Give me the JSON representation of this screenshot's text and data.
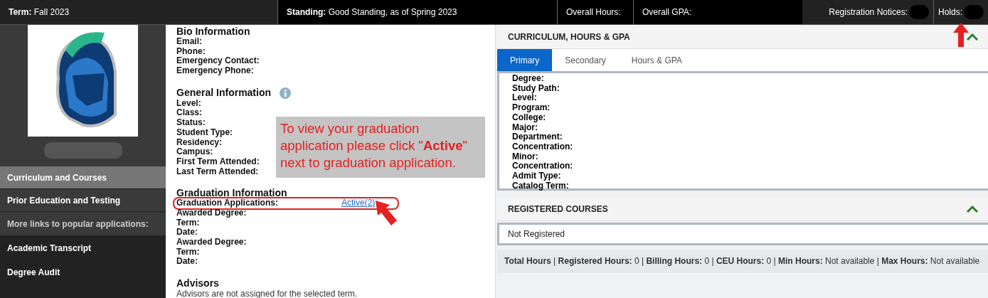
{
  "top_bar": {
    "term": "**Term:** Fall 2023",
    "standing": "**Standing:** Good Standing, as of Spring 2023",
    "overall_hours": "Overall Hours:",
    "overall_gpa": "Overall GPA:",
    "registration_notices": "Registration Notices:",
    "holds": "Holds:"
  },
  "sidebar": {
    "items": [
      {
        "label": "Curriculum and Courses",
        "kind": "tab",
        "selected": true
      },
      {
        "label": "Prior Education and Testing",
        "kind": "tab",
        "selected": false
      },
      {
        "label": "More links to popular applications:",
        "kind": "heading",
        "selected": false
      },
      {
        "label": "Academic Transcript",
        "kind": "link",
        "selected": false
      },
      {
        "label": "Degree Audit",
        "kind": "link",
        "selected": false
      }
    ]
  },
  "sections": [
    {
      "title": "Bio Information",
      "fields": [
        {
          "label": "Email:"
        },
        {
          "label": "Phone:"
        },
        {
          "label": "Emergency Contact:"
        },
        {
          "label": "Emergency Phone:"
        }
      ]
    },
    {
      "title": "General Information",
      "info": true,
      "fields": [
        {
          "label": "Level:"
        },
        {
          "label": "Class:"
        },
        {
          "label": "Status:"
        },
        {
          "label": "Student Type:"
        },
        {
          "label": "Residency:"
        },
        {
          "label": "Campus:"
        },
        {
          "label": "First Term Attended:"
        },
        {
          "label": "Last Term Attended:"
        }
      ]
    },
    {
      "title": "Graduation Information",
      "fields": [
        {
          "label": "Graduation Applications:",
          "value": "Active(2)",
          "highlighted": true
        },
        {
          "label": "Awarded Degree:"
        },
        {
          "label": "Term:"
        },
        {
          "label": "Date:"
        },
        {
          "label": "Awarded Degree:"
        },
        {
          "label": "Term:"
        },
        {
          "label": "Date:"
        }
      ]
    },
    {
      "title": "Advisors",
      "note": "Advisors are not assigned for the selected term."
    }
  ],
  "callout": "To view your graduation application please click \"**Active**\" next to graduation application.",
  "curriculum": {
    "title": "CURRICULUM, HOURS & GPA",
    "expanded": true,
    "tabs": [
      {
        "label": "Primary",
        "selected": true
      },
      {
        "label": "Secondary",
        "selected": false
      },
      {
        "label": "Hours & GPA",
        "selected": false
      }
    ],
    "fields": [
      "Degree:",
      "Study Path:",
      "Level:",
      "Program:",
      "College:",
      "Major:",
      "Department:",
      "Concentration:",
      "Minor:",
      "Concentration:",
      "Admit Type:",
      "Catalog Term:"
    ]
  },
  "registered": {
    "title": "REGISTERED COURSES",
    "expanded": true,
    "message": "Not Registered",
    "summary": "**Total Hours** |  **Registered Hours:**  0  |  **Billing Hours:**  0  |  **CEU Hours:**  0  | **Min Hours:**  Not available  |  **Max Hours:**  Not available"
  }
}
